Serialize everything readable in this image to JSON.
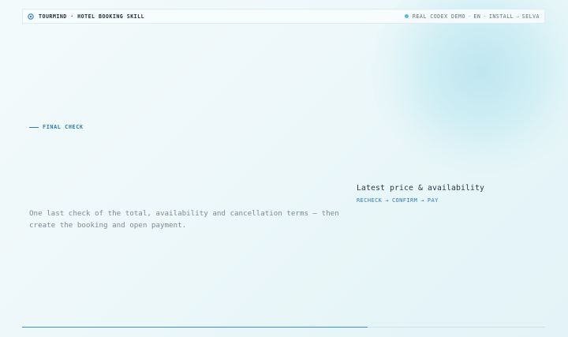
{
  "header": {
    "brand": "TOURMIND · HOTEL BOOKING SKILL",
    "nav": {
      "demo": "REAL CODEX DEMO",
      "sep1": "·",
      "lang": "EN",
      "sep2": "·",
      "install": "INSTALL",
      "arrow": "→",
      "selva": "SELVA"
    }
  },
  "section": {
    "eyebrow": "FINAL CHECK",
    "description": "One last check of the total, availability and cancellation terms — then create the booking and open payment."
  },
  "side": {
    "title": "Latest price & availability",
    "steps": [
      "RECHECK",
      "→",
      "CONFIRM",
      "→",
      "PAY"
    ]
  },
  "progress": {
    "fraction": 0.66
  },
  "colors": {
    "accent": "#2c7cc2",
    "live_dot": "#56b9e5",
    "progress": "#3e8ed2"
  },
  "icons": {
    "brand": "target-logo-icon",
    "status": "live-dot-icon"
  }
}
